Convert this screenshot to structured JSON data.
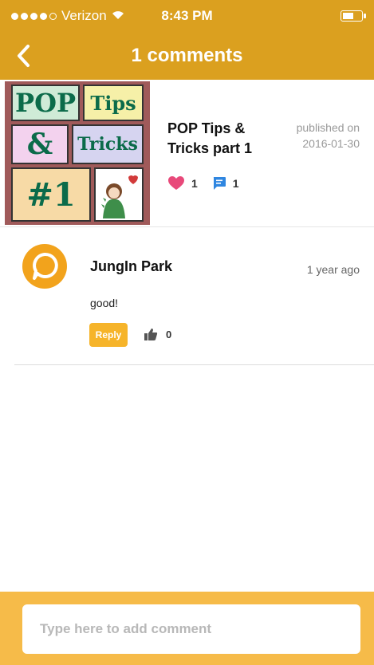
{
  "status_bar": {
    "carrier": "Verizon",
    "time": "8:43 PM"
  },
  "nav": {
    "title": "1 comments",
    "back_icon": "chevron-left-icon"
  },
  "post": {
    "thumbnail_words": [
      "POP",
      "Tips",
      "&",
      "Tricks",
      "#1"
    ],
    "title": "POP Tips & Tricks part 1",
    "published_label": "published on",
    "published_date": "2016-01-30",
    "likes": "1",
    "comments": "1",
    "like_icon": "heart-icon",
    "comment_icon": "comment-bubble-icon"
  },
  "comments": [
    {
      "author": "JungIn Park",
      "time": "1 year ago",
      "text": "good!",
      "reply_label": "Reply",
      "likes": "0",
      "like_icon": "thumbs-up-icon"
    }
  ],
  "composer": {
    "placeholder": "Type here to add comment"
  },
  "colors": {
    "header": "#DBA01F",
    "footer": "#F6BB49",
    "avatar": "#F2A31C",
    "reply": "#F6B42A",
    "heart": "#E8497A",
    "comment_icon": "#2F86E0"
  }
}
